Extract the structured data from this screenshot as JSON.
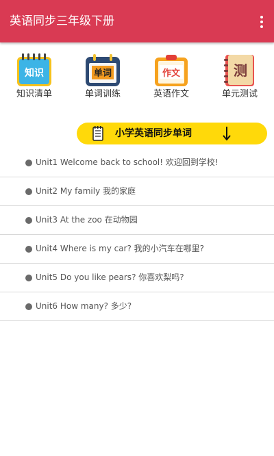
{
  "appbar": {
    "title": "英语同步三年级下册",
    "menu_icon": "more-vert-icon",
    "color": "#d93a53"
  },
  "features": [
    {
      "label": "知识清单",
      "icon_text": "知识",
      "icon": "knowledge-notebook-icon"
    },
    {
      "label": "单词训练",
      "icon_text": "单词",
      "icon": "word-calendar-icon"
    },
    {
      "label": "英语作文",
      "icon_text": "作文",
      "icon": "composition-clipboard-icon"
    },
    {
      "label": "单元测试",
      "icon_text": "测",
      "icon": "test-book-icon"
    }
  ],
  "banner": {
    "text": "小学英语同步单词",
    "icon": "notebook-icon",
    "arrow": "arrow-down-icon",
    "color": "#ffd90a"
  },
  "units": [
    {
      "label": "Unit1 Welcome back to school! 欢迎回到学校!"
    },
    {
      "label": "Unit2 My family 我的家庭"
    },
    {
      "label": "Unit3 At the zoo 在动物园"
    },
    {
      "label": "Unit4 Where is my car? 我的小汽车在哪里?"
    },
    {
      "label": "Unit5 Do you like pears? 你喜欢梨吗?"
    },
    {
      "label": "Unit6 How many? 多少?"
    }
  ]
}
